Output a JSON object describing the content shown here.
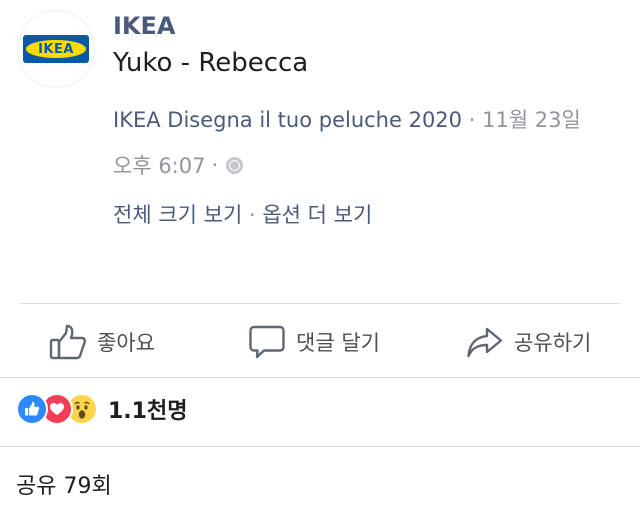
{
  "post": {
    "page_name": "IKEA",
    "title": "Yuko - Rebecca",
    "album": "IKEA Disegna il tuo peluche 2020",
    "separator": "·",
    "date": "11월 23일",
    "time": "오후 6:07",
    "time_sep": "·",
    "privacy_icon": "globe-icon",
    "links": {
      "view_full": "전체 크기 보기",
      "sep": "·",
      "more_options": "옵션 더 보기"
    }
  },
  "logo": {
    "text": "IKEA",
    "blue": "#0a58a8",
    "yellow": "#fedb00"
  },
  "actions": {
    "like": {
      "label": "좋아요",
      "icon": "thumbs-up-icon"
    },
    "comment": {
      "label": "댓글 달기",
      "icon": "speech-bubble-icon"
    },
    "share": {
      "label": "공유하기",
      "icon": "share-arrow-icon"
    }
  },
  "reactions": {
    "types": [
      "like",
      "love",
      "wow"
    ],
    "count": "1.1천명"
  },
  "shares": {
    "label": "공유 79회"
  },
  "colors": {
    "link": "#4b5a7b",
    "meta": "#90949c",
    "like": "#2e89ff",
    "love": "#f33e58",
    "wow": "#fcd44c"
  }
}
